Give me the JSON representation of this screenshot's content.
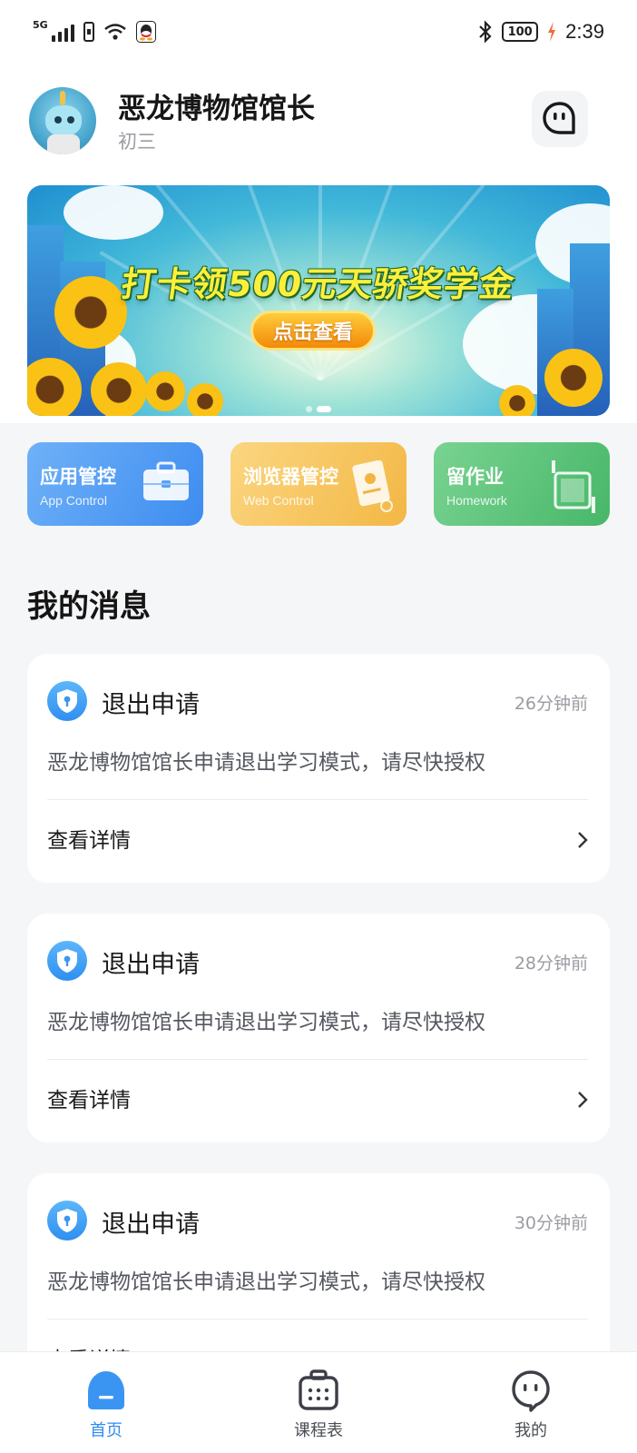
{
  "status_bar": {
    "network": "5G",
    "battery": "100",
    "time": "2:39",
    "icons": [
      "signal-icon",
      "sim-icon",
      "wifi-icon",
      "qq-icon",
      "bluetooth-icon",
      "battery-icon",
      "charging-icon"
    ]
  },
  "header": {
    "user_name": "恶龙博物馆馆长",
    "grade": "初三",
    "chat_icon": "chat-bubble-icon"
  },
  "banner": {
    "title": "打卡领500元天骄奖学金",
    "button": "点击查看",
    "active_dot": 1,
    "dot_count": 2
  },
  "quick_actions": [
    {
      "title": "应用管控",
      "subtitle": "App Control",
      "icon": "briefcase-icon",
      "color": "#4a94f2"
    },
    {
      "title": "浏览器管控",
      "subtitle": "Web Control",
      "icon": "document-icon",
      "color": "#f5c158"
    },
    {
      "title": "留作业",
      "subtitle": "Homework",
      "icon": "notebook-icon",
      "color": "#56bf74"
    }
  ],
  "messages_section": {
    "title": "我的消息",
    "items": [
      {
        "title": "退出申请",
        "time": "26分钟前",
        "body": "恶龙博物馆馆长申请退出学习模式，请尽快授权",
        "link": "查看详情"
      },
      {
        "title": "退出申请",
        "time": "28分钟前",
        "body": "恶龙博物馆馆长申请退出学习模式，请尽快授权",
        "link": "查看详情"
      },
      {
        "title": "退出申请",
        "time": "30分钟前",
        "body": "恶龙博物馆馆长申请退出学习模式，请尽快授权",
        "link": "查看详情"
      }
    ]
  },
  "bottom_nav": {
    "items": [
      {
        "label": "首页",
        "icon": "home-icon",
        "active": true
      },
      {
        "label": "课程表",
        "icon": "schedule-icon",
        "active": false
      },
      {
        "label": "我的",
        "icon": "profile-icon",
        "active": false
      }
    ]
  },
  "colors": {
    "accent": "#2f8cf0",
    "background": "#f5f6f8"
  }
}
